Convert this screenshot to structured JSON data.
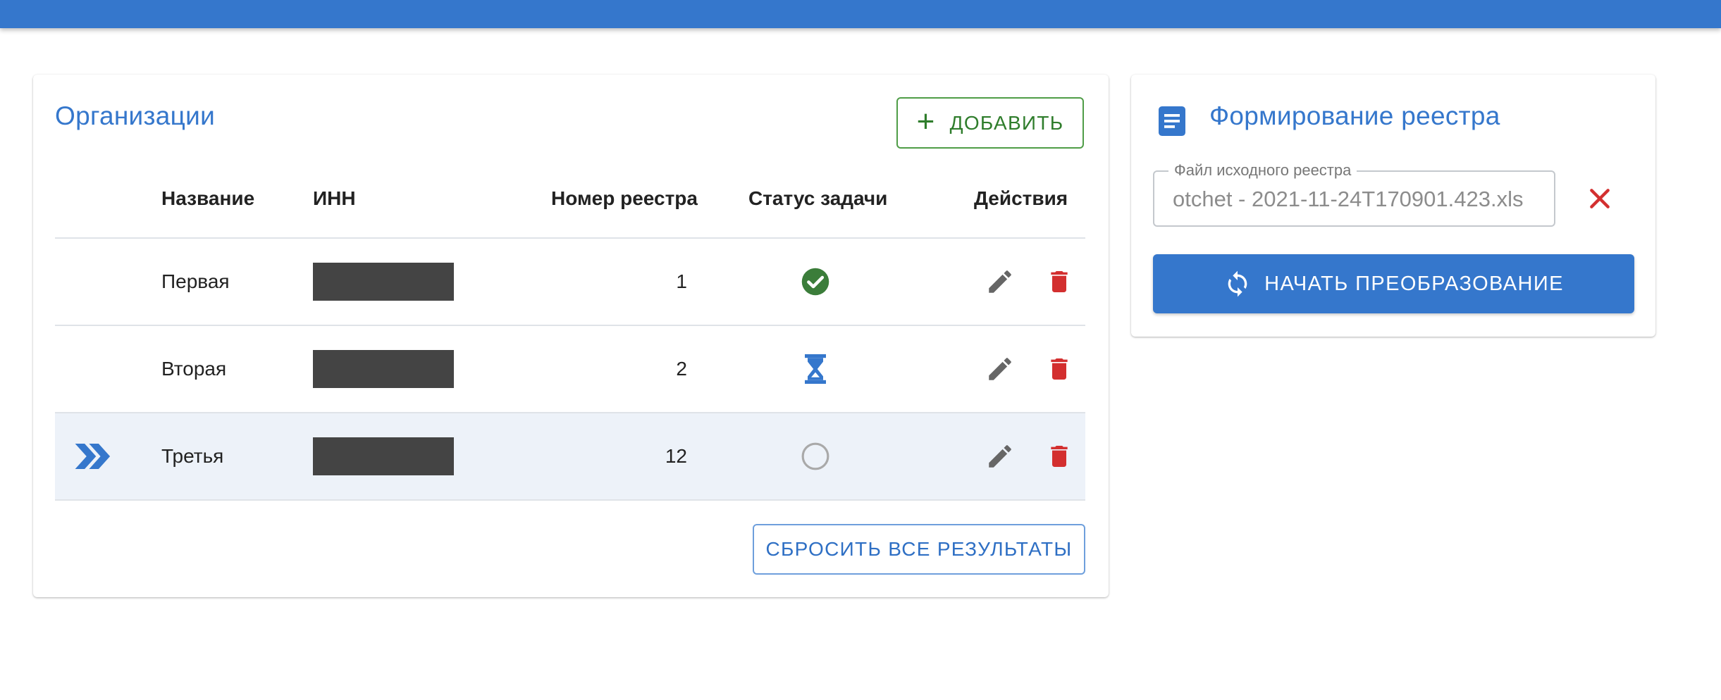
{
  "colors": {
    "topbar": "#3577cc",
    "accent": "#3577cc",
    "success": "#3b7d3a",
    "danger": "#d32f2f",
    "add_button": "#2f7d2c",
    "active_row": "#edf2f9"
  },
  "organizations": {
    "title": "Организации",
    "add_label": "Добавить",
    "columns": {
      "name": "Название",
      "inn": "ИНН",
      "registry_number": "Номер реестра",
      "task_status": "Статус задачи",
      "actions": "Действия"
    },
    "rows": [
      {
        "name": "Первая",
        "registry_number": "1",
        "status": "done",
        "status_icon": "check-circle-icon",
        "active": false
      },
      {
        "name": "Вторая",
        "registry_number": "2",
        "status": "in-progress",
        "status_icon": "hourglass-icon",
        "active": false
      },
      {
        "name": "Третья",
        "registry_number": "12",
        "status": "pending",
        "status_icon": "empty-circle-icon",
        "active": true
      }
    ],
    "reset_label": "Сбросить все результаты"
  },
  "registry": {
    "title": "Формирование реестра",
    "file_label": "Файл исходного реестра",
    "file_value": "otchet - 2021-11-24T170901.423.xls",
    "start_label": "Начать преобразование"
  }
}
